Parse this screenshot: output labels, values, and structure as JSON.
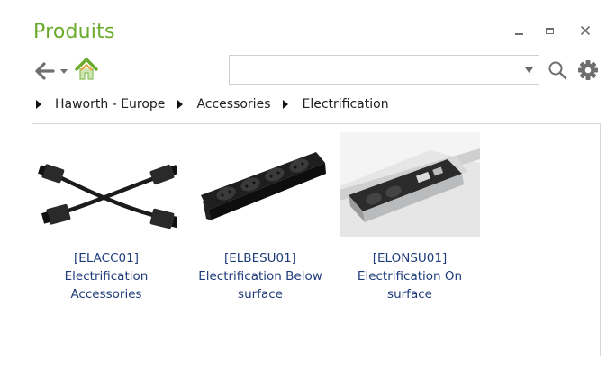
{
  "window": {
    "title": "Produits"
  },
  "toolbar": {
    "search": {
      "value": "",
      "placeholder": ""
    }
  },
  "breadcrumb": [
    "Haworth - Europe",
    "Accessories",
    "Electrification"
  ],
  "products": [
    {
      "code": "[ELACC01]",
      "name_line1": "Electrification",
      "name_line2": "Accessories"
    },
    {
      "code": "[ELBESU01]",
      "name_line1": "Electrification Below",
      "name_line2": "surface"
    },
    {
      "code": "[ELONSU01]",
      "name_line1": "Electrification On",
      "name_line2": "surface"
    }
  ],
  "icons": {
    "back": "arrow-left-icon",
    "dropdown": "chevron-down-icon",
    "home": "home-icon",
    "search": "search-icon",
    "settings": "gear-icon",
    "minimize": "minimize-icon",
    "maximize": "maximize-icon",
    "close": "close-icon"
  },
  "colors": {
    "title": "#6aab2c",
    "link": "#1f3c7a",
    "home": "#6aab2c"
  }
}
